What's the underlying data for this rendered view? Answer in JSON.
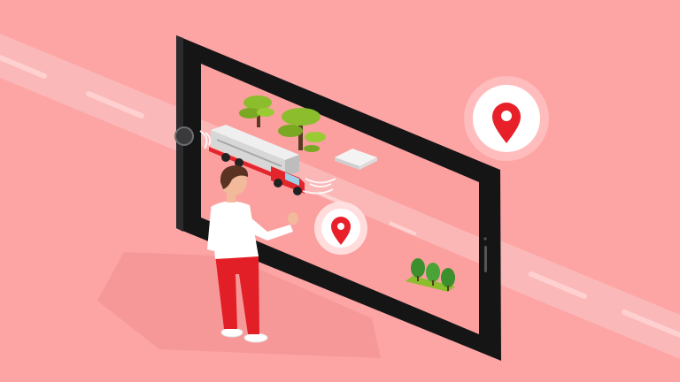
{
  "scene": {
    "kind": "illustration",
    "subject": "augmented-reality-map-on-smartphone",
    "palette": {
      "background": "#fda4a4",
      "road_band": "#fbb8b8",
      "road_dash": "#ffd2d2",
      "phone_frame": "#151516",
      "phone_screen": "#fb9f9f",
      "pin_red": "#e8202a",
      "pin_ring": "#ffe3e3",
      "truck_red": "#e3262c",
      "truck_grey": "#c9c9c9",
      "tree_green": "#8bbd2c",
      "tree_dark": "#3b8f2d",
      "person_shirt": "#ffffff",
      "person_pants": "#e21f26",
      "person_hair": "#5a3323",
      "skin": "#f2b99b"
    },
    "icons": [
      "location-pin-icon",
      "location-pin-icon",
      "signal-wave-icon",
      "tree-icon",
      "truck-icon",
      "building-icon"
    ]
  }
}
